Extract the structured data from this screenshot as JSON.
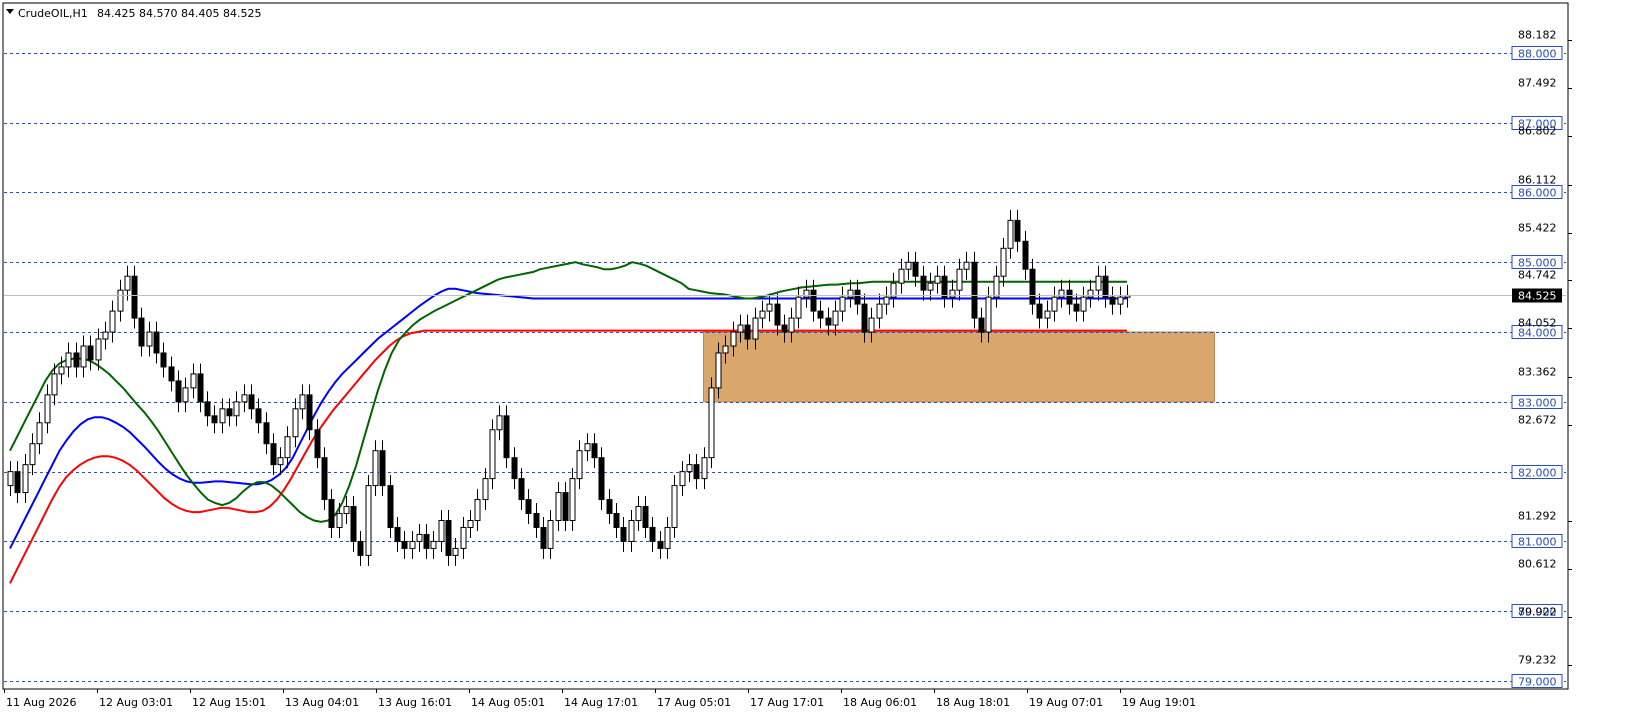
{
  "header": {
    "symbol_text": "CrudeOIL,H1",
    "ohlc_text": "84.425 84.570 84.405 84.525"
  },
  "chart_data": {
    "type": "candlestick",
    "symbol": "CrudeOIL",
    "timeframe": "H1",
    "ylim": [
      78.9,
      88.7
    ],
    "grid": false,
    "colors": {
      "ema_fast": "#006400",
      "ema_mid": "#0000ff",
      "ema_slow": "#ff0000",
      "hlines": "#2a4fb5",
      "zone": "#d9a66b",
      "current_price_bg": "#000000",
      "candle": "#000000"
    },
    "y_ticks": [
      "88.182",
      "87.492",
      "86.802",
      "86.112",
      "85.422",
      "84.742",
      "84.052",
      "83.362",
      "82.672",
      "81.292",
      "80.612",
      "79.922",
      "79.232"
    ],
    "x_ticks": [
      "11 Aug 2026",
      "12 Aug 03:01",
      "12 Aug 15:01",
      "13 Aug 04:01",
      "13 Aug 16:01",
      "14 Aug 05:01",
      "14 Aug 17:01",
      "17 Aug 05:01",
      "17 Aug 17:01",
      "18 Aug 06:01",
      "18 Aug 18:01",
      "19 Aug 07:01",
      "19 Aug 19:01"
    ],
    "horizontal_lines": [
      {
        "value": 88.0,
        "label": "88.000"
      },
      {
        "value": 87.0,
        "label": "87.000"
      },
      {
        "value": 86.0,
        "label": "86.000"
      },
      {
        "value": 85.0,
        "label": "85.000"
      },
      {
        "value": 84.0,
        "label": "84.000"
      },
      {
        "value": 83.0,
        "label": "83.000"
      },
      {
        "value": 82.0,
        "label": "82.000"
      },
      {
        "value": 81.0,
        "label": "81.000"
      },
      {
        "value": 80.0,
        "label": "80.000"
      },
      {
        "value": 79.0,
        "label": "79.000"
      }
    ],
    "current_price": {
      "value": 84.525,
      "label": "84.525"
    },
    "zone": {
      "from_bar": 95,
      "to_bar": 165,
      "price_low": 83.0,
      "price_high": 84.0
    },
    "closes": [
      82.0,
      81.7,
      82.1,
      82.4,
      82.7,
      83.1,
      83.4,
      83.5,
      83.7,
      83.5,
      83.8,
      83.6,
      83.9,
      84.0,
      84.3,
      84.6,
      84.8,
      84.2,
      83.8,
      84.0,
      83.7,
      83.5,
      83.3,
      83.0,
      83.2,
      83.4,
      83.0,
      82.8,
      82.7,
      82.9,
      82.8,
      83.0,
      83.1,
      82.9,
      82.7,
      82.4,
      82.1,
      82.2,
      82.5,
      82.9,
      83.1,
      82.6,
      82.2,
      81.6,
      81.2,
      81.4,
      81.5,
      81.0,
      80.8,
      81.8,
      82.3,
      81.8,
      81.2,
      81.0,
      80.9,
      81.0,
      81.1,
      80.9,
      81.0,
      81.3,
      80.8,
      80.9,
      81.2,
      81.3,
      81.6,
      81.9,
      82.6,
      82.8,
      82.2,
      81.9,
      81.6,
      81.4,
      81.2,
      80.9,
      81.3,
      81.7,
      81.3,
      81.9,
      82.3,
      82.4,
      82.2,
      81.6,
      81.4,
      81.2,
      81.0,
      81.3,
      81.5,
      81.2,
      81.0,
      80.9,
      81.2,
      81.8,
      82.0,
      82.1,
      81.9,
      82.2,
      83.2,
      83.7,
      83.8,
      84.0,
      84.1,
      83.9,
      84.2,
      84.3,
      84.4,
      84.1,
      84.0,
      84.2,
      84.5,
      84.6,
      84.3,
      84.2,
      84.1,
      84.3,
      84.5,
      84.6,
      84.4,
      84.0,
      84.2,
      84.4,
      84.5,
      84.7,
      84.9,
      85.0,
      84.8,
      84.6,
      84.7,
      84.8,
      84.5,
      84.6,
      84.9,
      85.0,
      84.2,
      84.0,
      84.5,
      84.8,
      85.2,
      85.6,
      85.3,
      84.9,
      84.4,
      84.2,
      84.3,
      84.5,
      84.6,
      84.4,
      84.3,
      84.5,
      84.6,
      84.8,
      84.5,
      84.4,
      84.5,
      84.525
    ],
    "ema_fast": [
      82.3,
      82.5,
      82.7,
      82.9,
      83.1,
      83.3,
      83.45,
      83.55,
      83.6,
      83.62,
      83.62,
      83.6,
      83.55,
      83.48,
      83.4,
      83.3,
      83.2,
      83.08,
      82.96,
      82.85,
      82.72,
      82.58,
      82.42,
      82.26,
      82.1,
      81.95,
      81.82,
      81.7,
      81.6,
      81.55,
      81.52,
      81.55,
      81.62,
      81.72,
      81.8,
      81.85,
      81.85,
      81.8,
      81.72,
      81.62,
      81.52,
      81.42,
      81.35,
      81.3,
      81.28,
      81.3,
      81.38,
      81.55,
      81.8,
      82.1,
      82.45,
      82.8,
      83.15,
      83.45,
      83.7,
      83.88,
      84.0,
      84.1,
      84.18,
      84.24,
      84.3,
      84.35,
      84.4,
      84.45,
      84.5,
      84.55,
      84.6,
      84.65,
      84.7,
      84.75,
      84.78,
      84.8,
      84.82,
      84.84,
      84.86,
      84.9,
      84.92,
      84.94,
      84.96,
      84.98,
      85.0,
      84.97,
      84.95,
      84.93,
      84.9,
      84.9,
      84.92,
      84.95,
      85.0,
      84.98,
      84.95,
      84.9,
      84.85,
      84.8,
      84.75,
      84.7,
      84.62,
      84.6,
      84.58,
      84.56,
      84.55,
      84.54,
      84.52,
      84.5,
      84.48,
      84.48,
      84.5,
      84.52,
      84.55,
      84.58,
      84.6,
      84.62,
      84.64,
      84.65,
      84.66,
      84.67,
      84.68,
      84.68,
      84.69,
      84.7,
      84.7,
      84.71,
      84.72,
      84.72,
      84.72,
      84.72,
      84.72,
      84.72,
      84.72,
      84.72,
      84.72,
      84.72,
      84.72,
      84.72,
      84.72,
      84.72,
      84.72,
      84.72,
      84.72,
      84.72,
      84.72,
      84.72,
      84.72,
      84.72,
      84.72,
      84.72,
      84.72,
      84.72,
      84.72,
      84.72,
      84.72,
      84.72,
      84.72,
      84.72,
      84.72,
      84.72,
      84.72,
      84.72,
      84.72
    ],
    "ema_mid": [
      80.9,
      81.1,
      81.3,
      81.5,
      81.7,
      81.9,
      82.1,
      82.3,
      82.45,
      82.58,
      82.68,
      82.75,
      82.78,
      82.78,
      82.75,
      82.7,
      82.64,
      82.56,
      82.46,
      82.36,
      82.25,
      82.14,
      82.04,
      81.96,
      81.9,
      81.86,
      81.84,
      81.84,
      81.85,
      81.86,
      81.86,
      81.85,
      81.84,
      81.83,
      81.82,
      81.82,
      81.84,
      81.88,
      81.95,
      82.05,
      82.2,
      82.4,
      82.6,
      82.8,
      82.98,
      83.14,
      83.28,
      83.4,
      83.5,
      83.6,
      83.7,
      83.8,
      83.9,
      83.98,
      84.06,
      84.14,
      84.22,
      84.3,
      84.38,
      84.45,
      84.52,
      84.58,
      84.62,
      84.62,
      84.6,
      84.58,
      84.56,
      84.55,
      84.54,
      84.53,
      84.52,
      84.51,
      84.5,
      84.49,
      84.48,
      84.48,
      84.48,
      84.48,
      84.48,
      84.48,
      84.48,
      84.48,
      84.48,
      84.48,
      84.48,
      84.48,
      84.48,
      84.48,
      84.48,
      84.48,
      84.48,
      84.48,
      84.48,
      84.48,
      84.48,
      84.48,
      84.48,
      84.48,
      84.48,
      84.48,
      84.48,
      84.48,
      84.48,
      84.48,
      84.48,
      84.48,
      84.48,
      84.48,
      84.48,
      84.48,
      84.48,
      84.48,
      84.48,
      84.48,
      84.48,
      84.48,
      84.48,
      84.48,
      84.48,
      84.48,
      84.48,
      84.48,
      84.48,
      84.48,
      84.48,
      84.48,
      84.48,
      84.48,
      84.48,
      84.48,
      84.48,
      84.48,
      84.48,
      84.48,
      84.48,
      84.48,
      84.48,
      84.48,
      84.48,
      84.48,
      84.48,
      84.48,
      84.48,
      84.48,
      84.48,
      84.48,
      84.48,
      84.48,
      84.48,
      84.48,
      84.48,
      84.48,
      84.48,
      84.48,
      84.48,
      84.48,
      84.48,
      84.48,
      84.48
    ],
    "ema_slow": [
      80.4,
      80.6,
      80.8,
      81.0,
      81.2,
      81.4,
      81.6,
      81.78,
      81.92,
      82.02,
      82.1,
      82.16,
      82.2,
      82.22,
      82.22,
      82.2,
      82.16,
      82.1,
      82.02,
      81.92,
      81.82,
      81.72,
      81.62,
      81.54,
      81.48,
      81.44,
      81.42,
      81.42,
      81.44,
      81.46,
      81.48,
      81.48,
      81.46,
      81.44,
      81.42,
      81.42,
      81.44,
      81.5,
      81.6,
      81.74,
      81.9,
      82.08,
      82.26,
      82.44,
      82.6,
      82.74,
      82.88,
      83.0,
      83.12,
      83.24,
      83.36,
      83.48,
      83.6,
      83.7,
      83.8,
      83.88,
      83.94,
      83.98,
      84.0,
      84.02,
      84.02,
      84.02,
      84.02,
      84.02,
      84.02,
      84.02,
      84.02,
      84.02,
      84.02,
      84.02,
      84.02,
      84.02,
      84.02,
      84.02,
      84.02,
      84.02,
      84.02,
      84.02,
      84.02,
      84.02,
      84.02,
      84.02,
      84.02,
      84.02,
      84.02,
      84.02,
      84.02,
      84.02,
      84.02,
      84.02,
      84.02,
      84.02,
      84.02,
      84.02,
      84.02,
      84.02,
      84.02,
      84.02,
      84.02,
      84.02,
      84.02,
      84.02,
      84.02,
      84.02,
      84.02,
      84.02,
      84.02,
      84.02,
      84.02,
      84.02,
      84.02,
      84.02,
      84.02,
      84.02,
      84.02,
      84.02,
      84.02,
      84.02,
      84.02,
      84.02,
      84.02,
      84.02,
      84.02,
      84.02,
      84.02,
      84.02,
      84.02,
      84.02,
      84.02,
      84.02,
      84.02,
      84.02,
      84.02,
      84.02,
      84.02,
      84.02,
      84.02,
      84.02,
      84.02,
      84.02,
      84.02,
      84.02,
      84.02,
      84.02,
      84.02,
      84.02,
      84.02,
      84.02,
      84.02,
      84.02,
      84.02,
      84.02,
      84.02,
      84.02,
      84.02,
      84.02,
      84.02,
      84.02,
      84.02,
      84.02
    ]
  }
}
